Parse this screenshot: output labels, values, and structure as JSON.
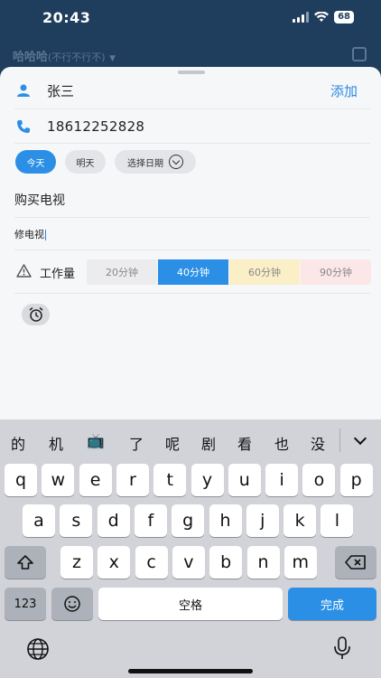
{
  "status": {
    "time": "20:43",
    "battery": "68"
  },
  "background": {
    "title": "哈哈哈",
    "subtitle": "(不行不行不)"
  },
  "form": {
    "name": "张三",
    "add_label": "添加",
    "phone": "18612252828",
    "dates": {
      "today": "今天",
      "tomorrow": "明天",
      "pick": "选择日期"
    },
    "task_title": "购买电视",
    "task_desc": "修电视",
    "workload": {
      "label": "工作量",
      "options": [
        "20分钟",
        "40分钟",
        "60分钟",
        "90分钟"
      ],
      "selected": "40分钟"
    }
  },
  "keyboard": {
    "candidates": [
      "的",
      "机",
      "📺",
      "了",
      "呢",
      "剧",
      "看",
      "也",
      "没"
    ],
    "row1": [
      "q",
      "w",
      "e",
      "r",
      "t",
      "y",
      "u",
      "i",
      "o",
      "p"
    ],
    "row2": [
      "a",
      "s",
      "d",
      "f",
      "g",
      "h",
      "j",
      "k",
      "l"
    ],
    "row3": [
      "z",
      "x",
      "c",
      "v",
      "b",
      "n",
      "m"
    ],
    "num_label": "123",
    "space_label": "空格",
    "done_label": "完成"
  },
  "colors": {
    "accent": "#2b8fe6",
    "header": "#1f3d5c"
  }
}
